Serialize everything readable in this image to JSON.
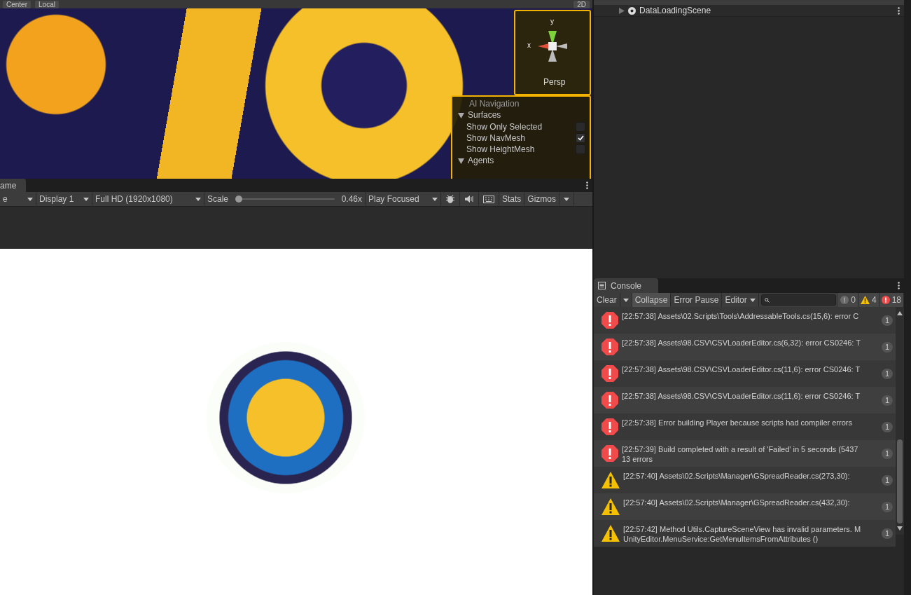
{
  "scene_toolbar": {
    "pivot": "Center",
    "space": "Local",
    "mode": "2D"
  },
  "scene_view": {
    "gizmo": {
      "y_label": "y",
      "x_label": "x",
      "projection": "Persp"
    },
    "ai_navigation": {
      "title": "AI Navigation",
      "sections": [
        {
          "label": "Surfaces",
          "expanded": true,
          "options": [
            {
              "label": "Show Only Selected",
              "checked": false
            },
            {
              "label": "Show NavMesh",
              "checked": true
            },
            {
              "label": "Show HeightMesh",
              "checked": false
            }
          ]
        },
        {
          "label": "Agents",
          "expanded": true
        }
      ]
    }
  },
  "game_view": {
    "tab": "ame",
    "toolbar": {
      "aspect": "e",
      "display": "Display 1",
      "resolution": "Full HD (1920x1080)",
      "scale_label": "Scale",
      "scale": {
        "level": 0.0
      },
      "scale_reading": "0.46x",
      "play_mode": "Play Focused",
      "stats": "Stats",
      "gizmos": "Gizmos"
    }
  },
  "hierarchy": {
    "items": [
      {
        "label": "DataLoadingScene",
        "expanded": false
      }
    ]
  },
  "console": {
    "tab": "Console",
    "toolbar": {
      "clear": "Clear",
      "collapse": {
        "label": "Collapse",
        "on": true
      },
      "error_pause": {
        "label": "Error Pause",
        "on": false
      },
      "editor": "Editor"
    },
    "counts": {
      "info": "0",
      "warnings": "4",
      "errors": "18"
    },
    "entries": [
      {
        "kind": "error",
        "lines": [
          "[22:57:38] Assets\\02.Scripts\\Tools\\AddressableTools.cs(15,6): error C"
        ],
        "count": "1"
      },
      {
        "kind": "error",
        "lines": [
          "[22:57:38] Assets\\98.CSV\\CSVLoaderEditor.cs(6,32): error CS0246: T"
        ],
        "count": "1"
      },
      {
        "kind": "error",
        "lines": [
          "[22:57:38] Assets\\98.CSV\\CSVLoaderEditor.cs(11,6): error CS0246: T"
        ],
        "count": "1"
      },
      {
        "kind": "error",
        "lines": [
          "[22:57:38] Assets\\98.CSV\\CSVLoaderEditor.cs(11,6): error CS0246: T"
        ],
        "count": "1"
      },
      {
        "kind": "error",
        "lines": [
          "[22:57:38] Error building Player because scripts had compiler errors"
        ],
        "count": "1"
      },
      {
        "kind": "error",
        "lines": [
          "[22:57:39] Build completed with a result of 'Failed' in 5 seconds (5437",
          "13 errors"
        ],
        "count": "1"
      },
      {
        "kind": "warning",
        "lines": [
          "[22:57:40] Assets\\02.Scripts\\Manager\\GSpreadReader.cs(273,30):"
        ],
        "count": "1"
      },
      {
        "kind": "warning",
        "lines": [
          "[22:57:40] Assets\\02.Scripts\\Manager\\GSpreadReader.cs(432,30):"
        ],
        "count": "1"
      },
      {
        "kind": "warning",
        "lines": [
          "[22:57:42] Method Utils.CaptureSceneView has invalid parameters. M",
          "UnityEditor.MenuService:GetMenuItemsFromAttributes ()"
        ],
        "count": "1"
      }
    ]
  }
}
